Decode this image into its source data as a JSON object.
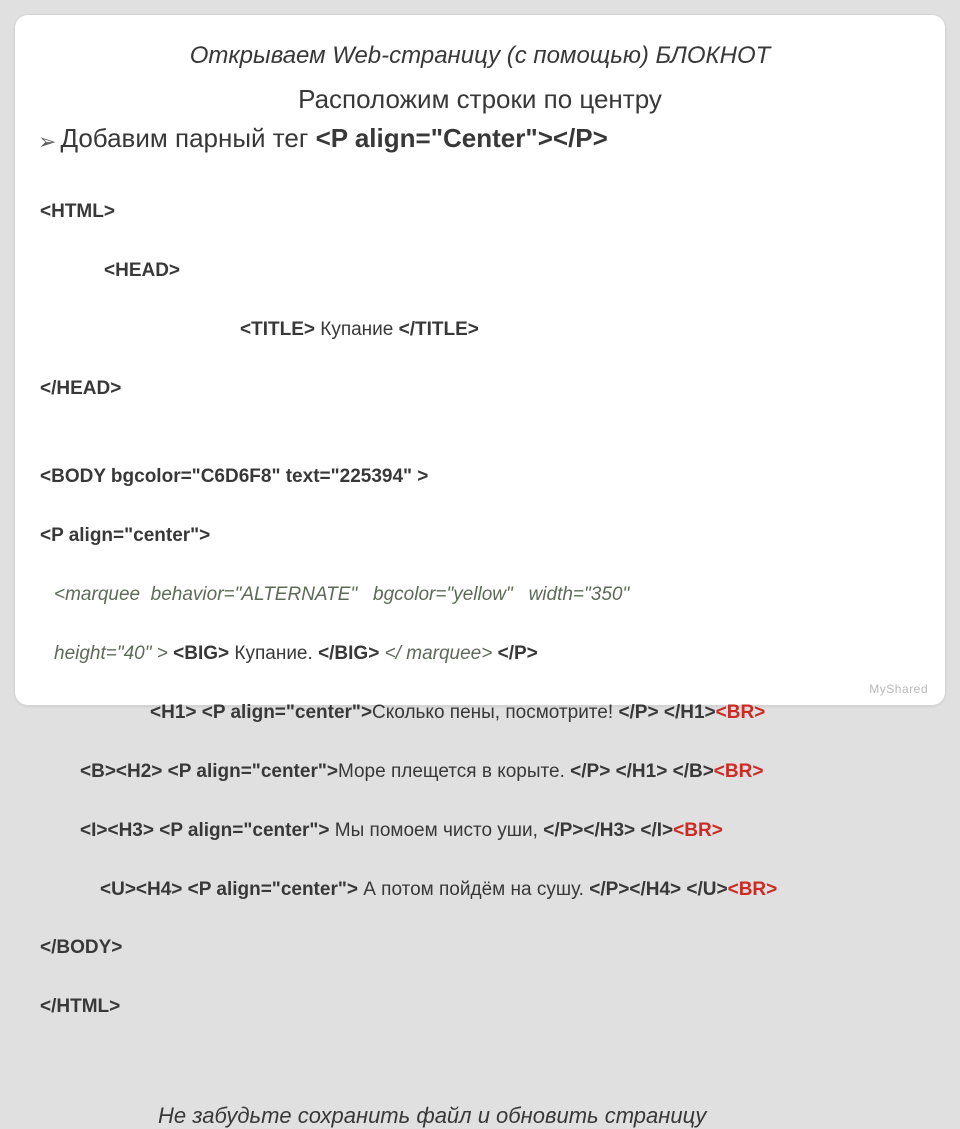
{
  "header": "Открываем Web-страницу (с помощью) БЛОКНОТ",
  "subhead": "Расположим строки по центру",
  "bullet_pre": "Добавим парный тег ",
  "bullet_tag": "<P align=\"Center\"></P>",
  "code": {
    "l1": "<HTML>",
    "l2": "<HEAD>",
    "l3_a": "<TITLE>",
    "l3_b": " Купание ",
    "l3_c": "</TITLE>",
    "l4": "</HEAD>",
    "l5": "",
    "l6": "<BODY bgcolor=\"C6D6F8\" text=\"225394\" >",
    "l7": "<P align=\"center\">",
    "l8a": "<marquee  behavior=\"ALTERNATE\"   bgcolor=\"yellow\"   width=\"350\"",
    "l8b_a": "height=\"40\" >",
    "l8b_b": " <BIG>",
    "l8b_c": " Купание. ",
    "l8b_d": "</BIG>",
    "l8b_e": " </ marquee>",
    "l8b_f": " </P>",
    "h1_open": "<H1> <P align=\"center\">",
    "h1_text": "Сколько пены, посмотрите! ",
    "h1_close": "</P> </H1>",
    "h2_open": "<B><H2> <P align=\"center\">",
    "h2_text": "Море плещется в корыте. ",
    "h2_close": "</P> </H1> </B>",
    "h3_open": "<I><H3> <P align=\"center\">",
    "h3_text": " Мы помоем чисто уши, ",
    "h3_close": "</P></H3> </I>",
    "h4_open": "<U><H4> <P align=\"center\">",
    "h4_text": " А потом пойдём на сушу. ",
    "h4_close": "</P></H4> </U>",
    "br": "<BR>",
    "body_close": "</BODY>",
    "html_close": "</HTML>"
  },
  "footer": "Не забудьте сохранить файл и обновить страницу",
  "brand": "MyShared"
}
